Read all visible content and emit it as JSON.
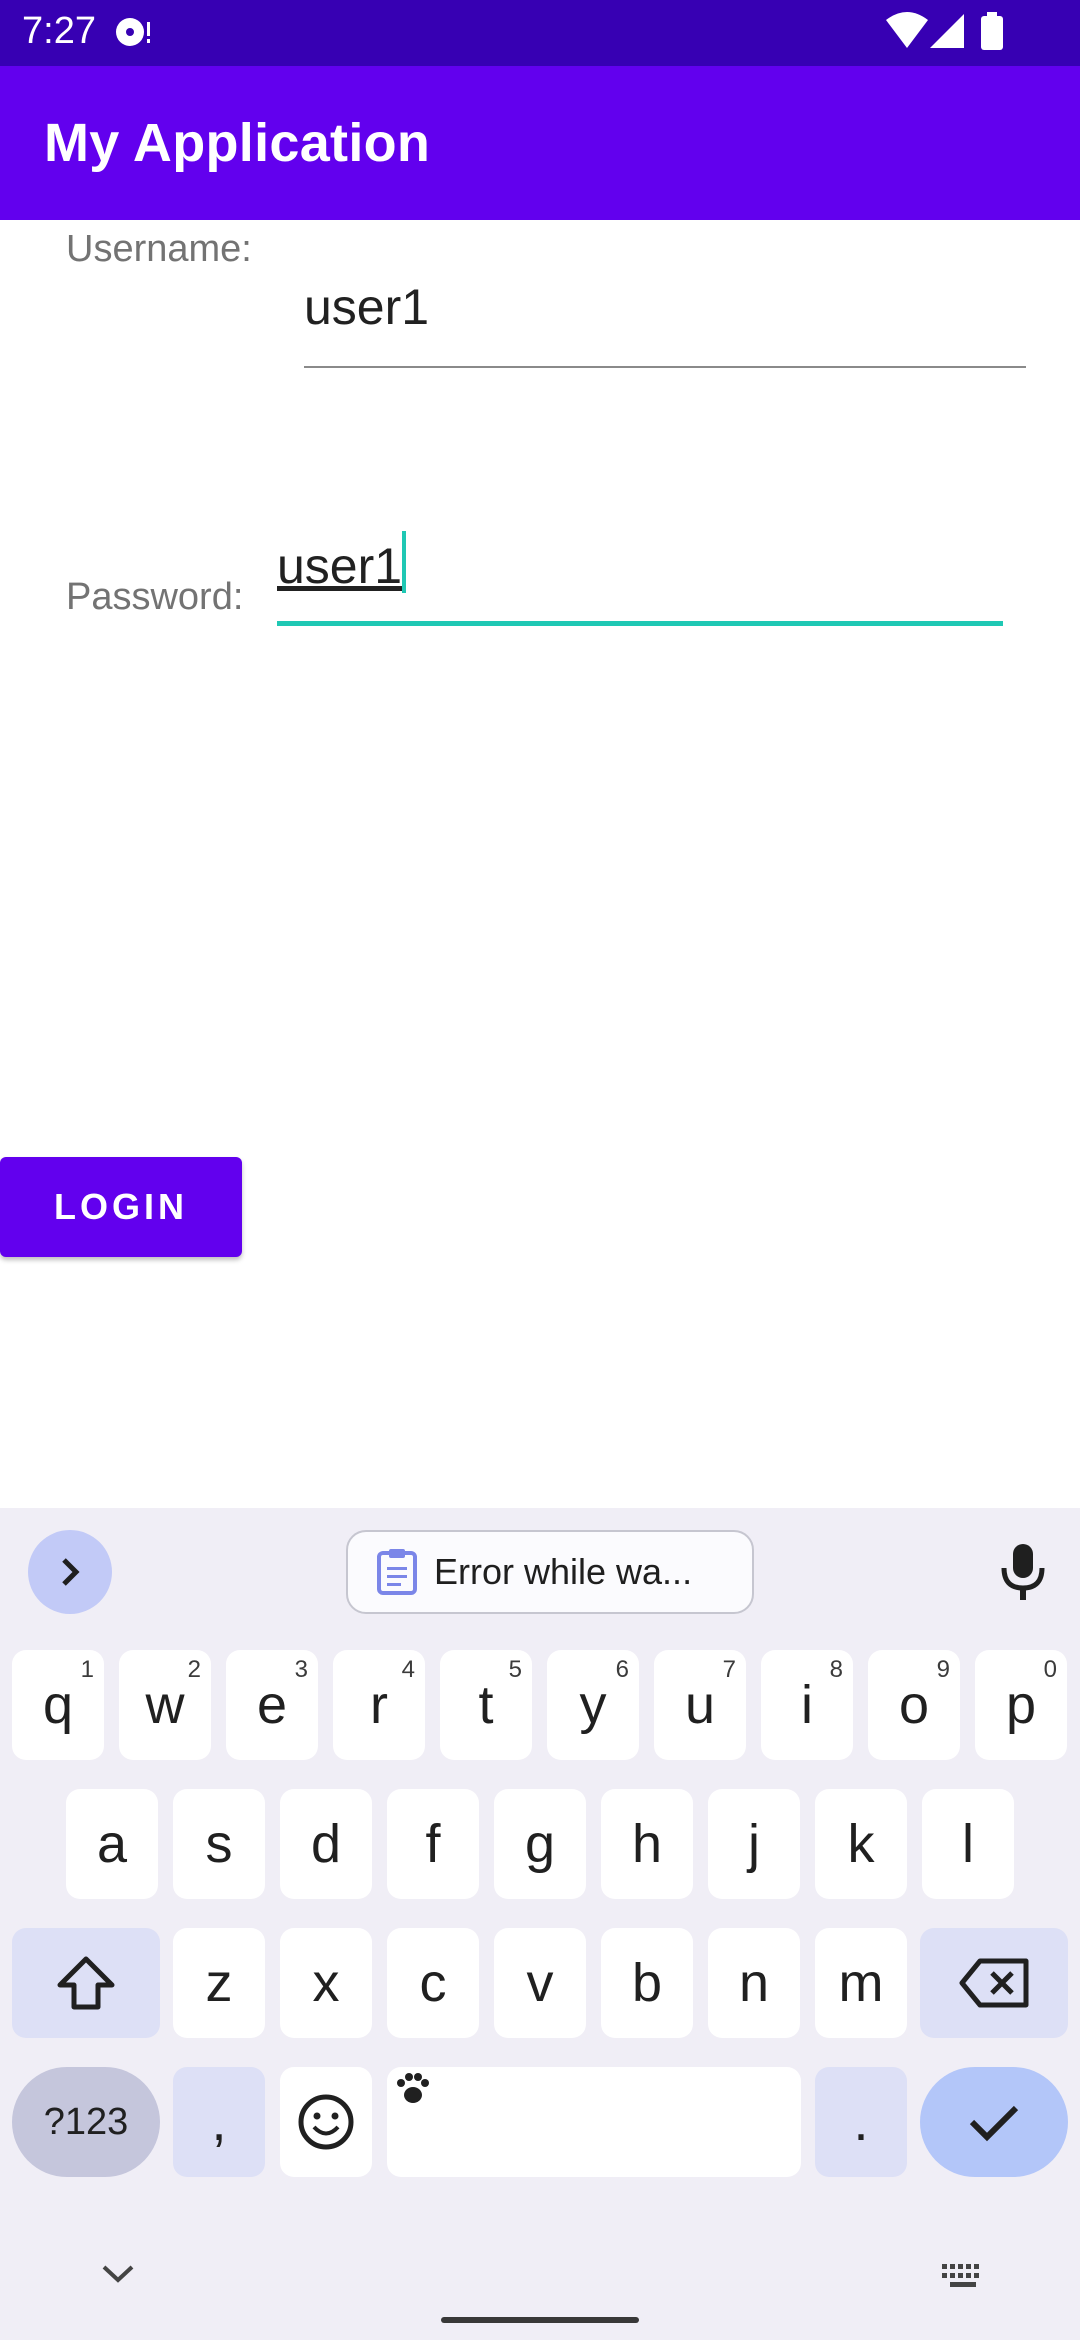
{
  "status_bar": {
    "time": "7:27",
    "icons": [
      "media-sync-icon",
      "wifi-icon",
      "signal-icon",
      "battery-icon"
    ]
  },
  "app_bar": {
    "title": "My Application"
  },
  "form": {
    "username_label": "Username:",
    "username_value": "user1",
    "password_label": "Password:",
    "password_value": "user1",
    "login_label": "LOGIN"
  },
  "keyboard": {
    "clipboard_suggestion": "Error while wa...",
    "row1": [
      {
        "key": "q",
        "hint": "1"
      },
      {
        "key": "w",
        "hint": "2"
      },
      {
        "key": "e",
        "hint": "3"
      },
      {
        "key": "r",
        "hint": "4"
      },
      {
        "key": "t",
        "hint": "5"
      },
      {
        "key": "y",
        "hint": "6"
      },
      {
        "key": "u",
        "hint": "7"
      },
      {
        "key": "i",
        "hint": "8"
      },
      {
        "key": "o",
        "hint": "9"
      },
      {
        "key": "p",
        "hint": "0"
      }
    ],
    "row2": [
      "a",
      "s",
      "d",
      "f",
      "g",
      "h",
      "j",
      "k",
      "l"
    ],
    "row3": [
      "z",
      "x",
      "c",
      "v",
      "b",
      "n",
      "m"
    ],
    "symbols_label": "?123",
    "comma_label": ",",
    "period_label": "."
  },
  "colors": {
    "status_bar": "#3700b3",
    "primary": "#6200ee",
    "accent": "#1fc8b4",
    "keyboard_bg": "#f0eef6"
  }
}
